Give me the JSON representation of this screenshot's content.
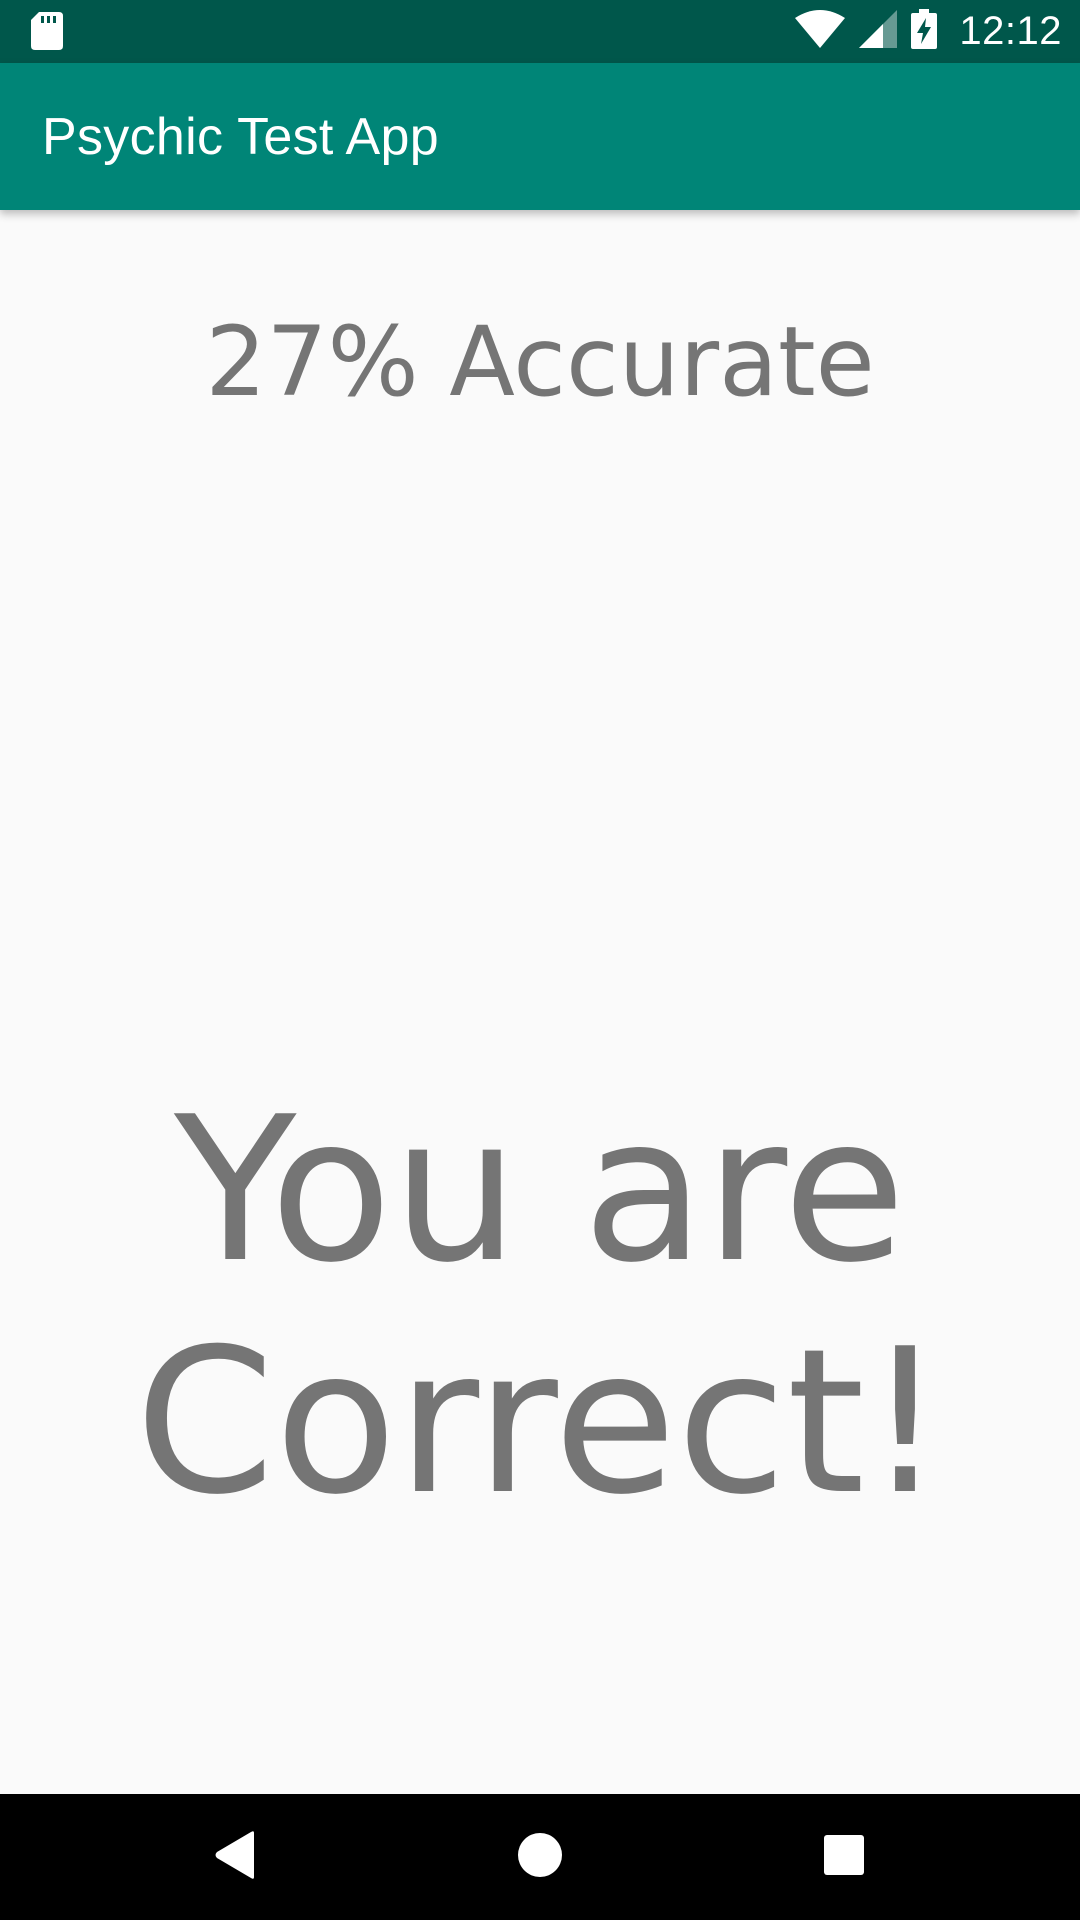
{
  "status_bar": {
    "time": "12:12",
    "icons": [
      "sd-card-icon",
      "wifi-icon",
      "cell-signal-icon",
      "battery-charging-icon"
    ],
    "background_color": "#00574b"
  },
  "app_bar": {
    "title": "Psychic Test App",
    "background_color": "#008577"
  },
  "content": {
    "accuracy_text": "27% Accurate",
    "result_line1": "You are",
    "result_line2": "Correct!",
    "text_color": "#757575"
  },
  "nav_bar": {
    "icons": [
      "back-icon",
      "home-icon",
      "recents-icon"
    ]
  }
}
